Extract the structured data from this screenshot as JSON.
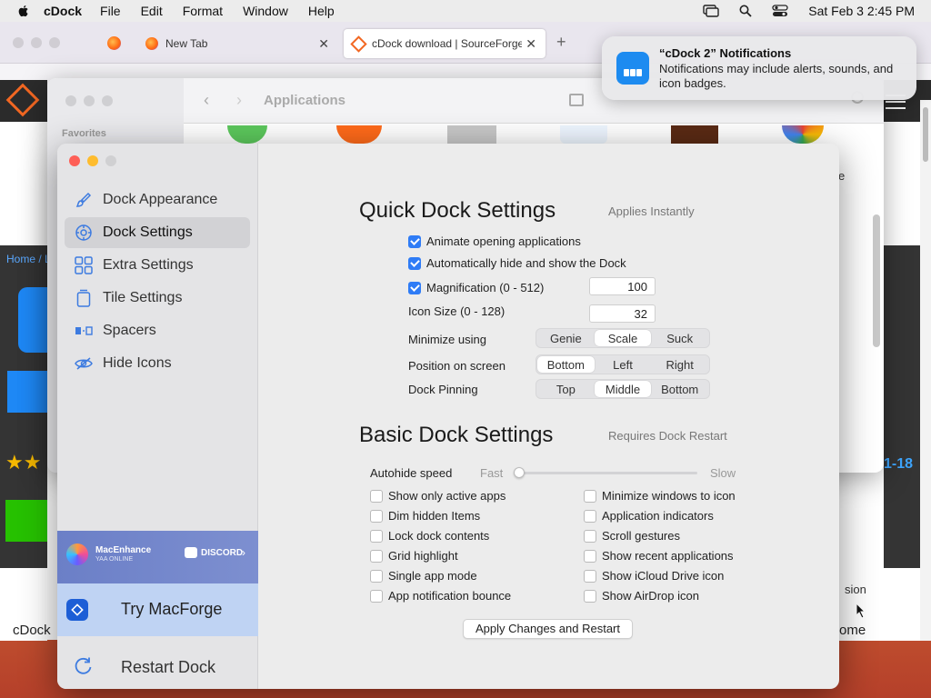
{
  "menubar": {
    "app": "cDock",
    "items": [
      "File",
      "Edit",
      "Format",
      "Window",
      "Help"
    ],
    "clock": "Sat Feb 3  2:45 PM"
  },
  "browser": {
    "tabs": [
      {
        "label": "New Tab"
      },
      {
        "label": "cDock download | SourceForge"
      }
    ],
    "page_fragments": {
      "breadcrumb": "Home / L",
      "left_bottom": "cDock",
      "right_date": "1-18",
      "right_sion": "sion",
      "right_ome": "ome",
      "right_e": "e"
    }
  },
  "finder": {
    "title": "Applications",
    "sidebar_heading": "Favorites"
  },
  "notification": {
    "title": "“cDock 2” Notifications",
    "body": "Notifications may include alerts, sounds, and icon badges."
  },
  "cdock": {
    "nav": [
      {
        "label": "Dock Appearance",
        "icon": "paintbrush-icon"
      },
      {
        "label": "Dock Settings",
        "icon": "gear-icon"
      },
      {
        "label": "Extra Settings",
        "icon": "grid-icon"
      },
      {
        "label": "Tile Settings",
        "icon": "tile-icon"
      },
      {
        "label": "Spacers",
        "icon": "spacer-icon"
      },
      {
        "label": "Hide Icons",
        "icon": "eye-slash-icon"
      }
    ],
    "banner_macenhance": {
      "title": "MacEnhance",
      "subtitle": "YAA ONLINE",
      "discord": "DISCORD"
    },
    "try_macforge": "Try MacForge",
    "restart_dock": "Restart Dock",
    "quick": {
      "title": "Quick Dock Settings",
      "note": "Applies Instantly",
      "checks": [
        {
          "label": "Animate opening applications",
          "checked": true
        },
        {
          "label": "Automatically hide and show the Dock",
          "checked": true
        },
        {
          "label": "Magnification (0 - 512)",
          "checked": true
        }
      ],
      "magnification_value": "100",
      "icon_size_label": "Icon Size (0 - 128)",
      "icon_size_value": "32",
      "minimize_label": "Minimize using",
      "minimize_options": [
        "Genie",
        "Scale",
        "Suck"
      ],
      "minimize_selected": "Scale",
      "position_label": "Position on screen",
      "position_options": [
        "Bottom",
        "Left",
        "Right"
      ],
      "position_selected": "Bottom",
      "pinning_label": "Dock Pinning",
      "pinning_options": [
        "Top",
        "Middle",
        "Bottom"
      ],
      "pinning_selected": "Middle"
    },
    "basic": {
      "title": "Basic Dock Settings",
      "note": "Requires Dock Restart",
      "autohide_label": "Autohide speed",
      "fast": "Fast",
      "slow": "Slow",
      "autohide_value": 0,
      "left_checks": [
        "Show only active apps",
        "Dim hidden Items",
        "Lock dock contents",
        "Grid highlight",
        "Single app mode",
        "App notification bounce"
      ],
      "right_checks": [
        "Minimize windows to icon",
        "Application indicators",
        "Scroll gestures",
        "Show recent applications",
        "Show iCloud Drive icon",
        "Show AirDrop icon"
      ],
      "apply_button": "Apply Changes and Restart"
    }
  }
}
